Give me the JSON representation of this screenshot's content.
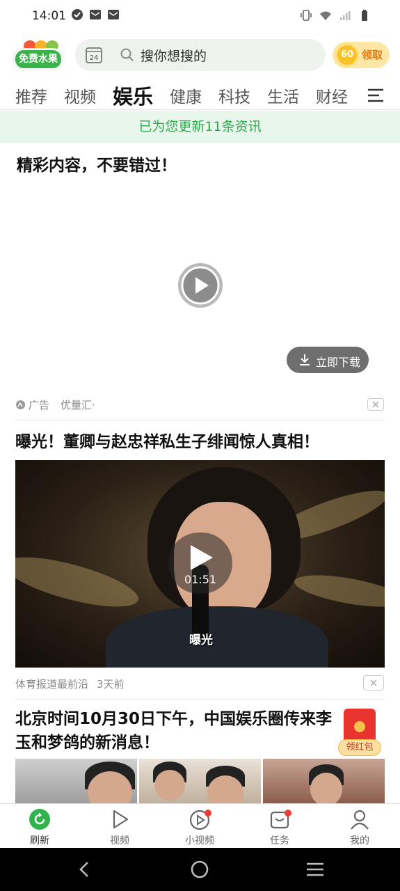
{
  "status_bar": {
    "time": "14:01",
    "left_icons": [
      "check-circle-icon",
      "mail-icon",
      "mail-icon"
    ],
    "right_icons": [
      "vibrate-icon",
      "wifi-icon",
      "signal-icon",
      "battery-icon"
    ]
  },
  "header": {
    "logo_text": "免费水果",
    "calendar_day": "24",
    "search_placeholder": "搜你想搜的",
    "reward_coins": "60",
    "reward_label": "领取"
  },
  "tabs": {
    "items": [
      {
        "label": "推荐",
        "active": false
      },
      {
        "label": "视频",
        "active": false
      },
      {
        "label": "娱乐",
        "active": true
      },
      {
        "label": "健康",
        "active": false
      },
      {
        "label": "科技",
        "active": false
      },
      {
        "label": "生活",
        "active": false
      },
      {
        "label": "财经",
        "active": false
      }
    ]
  },
  "notice": "已为您更新11条资讯",
  "ad": {
    "title": "精彩内容，不要错过！",
    "download_label": "立即下载",
    "tag": "广告",
    "source": "优量汇·"
  },
  "news": [
    {
      "title": "曝光！董卿与赵忠祥私生子绯闻惊人真相！",
      "duration": "01:51",
      "caption": "曝光",
      "source": "体育报道最前沿",
      "time": "3天前"
    },
    {
      "title": "北京时间10月30日下午，中国娱乐圈传来李玉和梦鸽的新消息！"
    }
  ],
  "red_packet": {
    "label": "领红包"
  },
  "bottom_nav": {
    "items": [
      {
        "label": "刷新",
        "icon": "refresh-icon"
      },
      {
        "label": "视频",
        "icon": "video-play-icon"
      },
      {
        "label": "小视频",
        "icon": "short-video-icon"
      },
      {
        "label": "任务",
        "icon": "task-icon"
      },
      {
        "label": "我的",
        "icon": "profile-icon"
      }
    ]
  },
  "colors": {
    "brand_green": "#2fa84f",
    "notice_bg": "#e9f6ec",
    "reward_orange": "#e07a10",
    "badge_red": "#f23b3b"
  }
}
